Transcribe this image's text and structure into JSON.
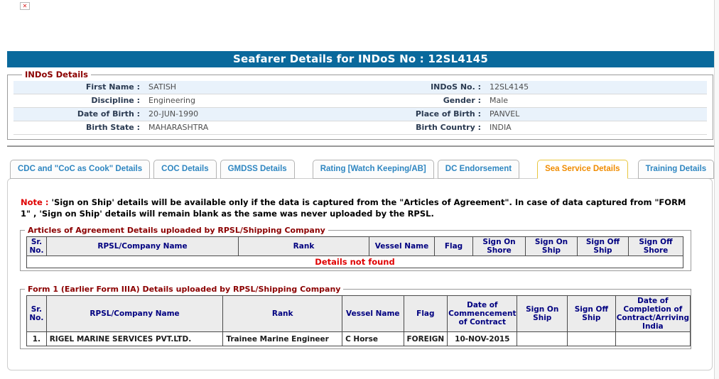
{
  "page": {
    "title": "Seafarer Details for INDoS No : 12SL4145"
  },
  "colors": {
    "titlebar_bg": "#0a699c",
    "legend_maroon": "#8b0000",
    "tab_blue": "#2e86c1",
    "tab_active_orange": "#f08c00",
    "tab_active_border": "#e8c63e",
    "table_header_text": "#000080",
    "note_red": "#e00000",
    "alt_row_bg": "#e9f2fb"
  },
  "indos": {
    "legend": "INDoS Details",
    "rows": [
      {
        "l_label": "First Name :",
        "l_value": "SATISH",
        "r_label": "INDoS No. :",
        "r_value": "12SL4145"
      },
      {
        "l_label": "Discipline :",
        "l_value": "Engineering",
        "r_label": "Gender :",
        "r_value": "Male"
      },
      {
        "l_label": "Date of Birth :",
        "l_value": "20-JUN-1990",
        "r_label": "Place of Birth :",
        "r_value": "PANVEL"
      },
      {
        "l_label": "Birth State :",
        "l_value": "MAHARASHTRA",
        "r_label": "Birth Country :",
        "r_value": "INDIA"
      }
    ]
  },
  "tabs": [
    {
      "label": "CDC and \"CoC as Cook\" Details",
      "active": false
    },
    {
      "label": "COC Details",
      "active": false
    },
    {
      "label": "GMDSS Details",
      "active": false
    },
    {
      "label": "Rating [Watch Keeping/AB]",
      "active": false
    },
    {
      "label": "DC Endorsement",
      "active": false
    },
    {
      "label": "Sea Service Details",
      "active": true
    },
    {
      "label": "Training Details",
      "active": false
    }
  ],
  "note": {
    "prefix": "Note :",
    "body": " 'Sign on Ship' details will be available only if the data is captured from the \"Articles of Agreement\". In case of data captured from \"FORM 1\" , 'Sign on Ship' details will remain blank as the same was never uploaded by the RPSL."
  },
  "agreement": {
    "legend": "Articles of Agreement Details uploaded by RPSL/Shipping Company",
    "headers": [
      "Sr. No.",
      "RPSL/Company Name",
      "Rank",
      "Vessel Name",
      "Flag",
      "Sign On Shore",
      "Sign On Ship",
      "Sign Off Ship",
      "Sign Off Shore"
    ],
    "empty_message": "Details not found"
  },
  "form1": {
    "legend": "Form 1 (Earlier Form IIIA) Details uploaded by RPSL/Shipping Company",
    "headers": [
      "Sr. No.",
      "RPSL/Company Name",
      "Rank",
      "Vessel Name",
      "Flag",
      "Date of Commencement of Contract",
      "Sign On Ship",
      "Sign Off Ship",
      "Date of Completion of Contract/Arriving India"
    ],
    "rows": [
      {
        "cells": [
          "1.",
          "RIGEL MARINE SERVICES PVT.LTD.",
          "Trainee Marine Engineer",
          "C Horse",
          "FOREIGN",
          "10-NOV-2015",
          "",
          "",
          ""
        ]
      }
    ]
  }
}
